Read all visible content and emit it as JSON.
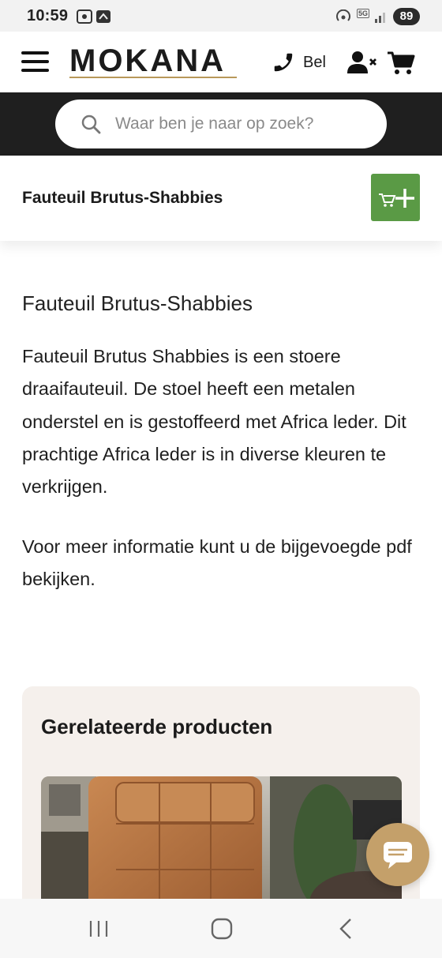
{
  "status_bar": {
    "time": "10:59",
    "network": "5G",
    "battery": "89"
  },
  "header": {
    "logo": "MOKANA",
    "call_label": "Bel",
    "icons": [
      "menu-icon",
      "phone-icon",
      "user-x-icon",
      "cart-icon"
    ]
  },
  "search": {
    "placeholder": "Waar ben je naar op zoek?"
  },
  "product_bar": {
    "title": "Fauteuil Brutus-Shabbies",
    "add_to_cart_icon": "cart-plus-icon"
  },
  "content": {
    "title": "Fauteuil Brutus-Shabbies",
    "paragraph1": "Fauteuil Brutus Shabbies is een stoere draaifauteuil. De stoel heeft een metalen onderstel en is gestoffeerd met Africa leder. Dit prachtige Africa leder is in diverse kleuren te verkrijgen.",
    "paragraph2": "Voor meer informatie kunt u de bijgevoegde pdf bekijken."
  },
  "related": {
    "title": "Gerelateerde producten"
  },
  "colors": {
    "accent_gold": "#b8985a",
    "add_to_cart_green": "#5a9a45",
    "chat_bubble": "#c4a06a",
    "search_band": "#1f1f1f",
    "related_bg": "#f5f0ec"
  }
}
